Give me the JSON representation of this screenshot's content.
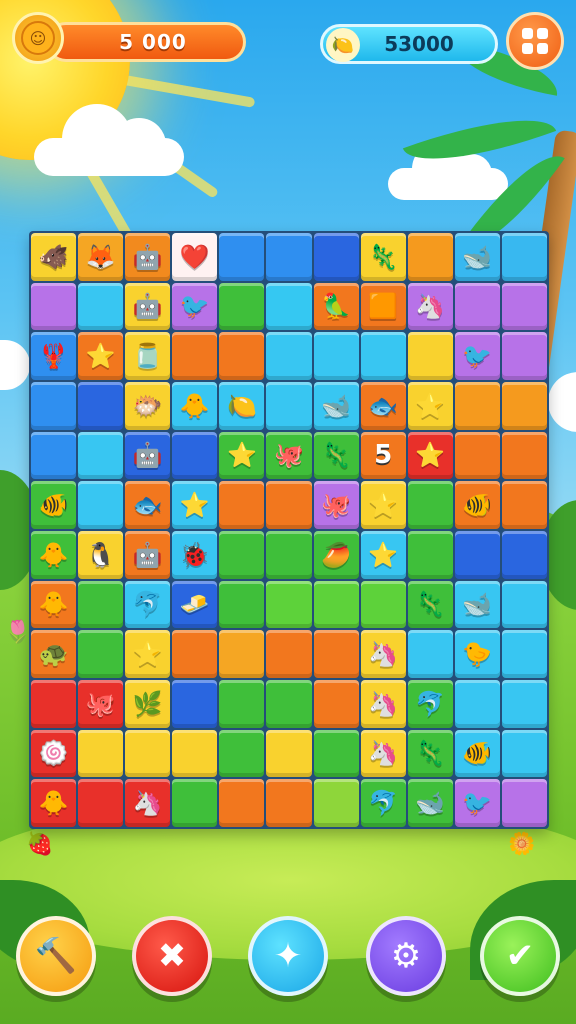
{
  "hud": {
    "score": "5 000",
    "gems": "53000",
    "coin_icon": "coin-icon",
    "gem_icon": "lemon-gem-icon",
    "menu_icon": "grid-menu-icon"
  },
  "board": {
    "cols": 11,
    "rows": 12,
    "cells": [
      [
        "#f9d22e",
        "🐗",
        "#f5a623",
        "🦊",
        "#f28a1e",
        "🤖",
        "#fff2f2",
        "❤️",
        "#2f8ff0",
        "",
        "#2f8ff0",
        "",
        "#2a66e0",
        "",
        "#f9d22e",
        "🦎",
        "#f59a1e",
        "",
        "#38b8f0",
        "🐋",
        "#38b8f0",
        ""
      ],
      [
        "#b772e8",
        "",
        "#38c6f2",
        "",
        "#f9d22e",
        "🤖",
        "#b772e8",
        "🐦",
        "#3fbf3a",
        "",
        "#35c8f2",
        "",
        "#f2771e",
        "🦜",
        "#f2771e",
        "🟧",
        "#b772e8",
        "🦄",
        "#b772e8",
        "",
        "#b772e8",
        ""
      ],
      [
        "#2f8ff0",
        "🦞",
        "#f2771e",
        "⭐",
        "#f9d22e",
        "🫙",
        "#f2771e",
        "",
        "#f2771e",
        "",
        "#38c6f2",
        "",
        "#38c6f2",
        "",
        "#38c6f2",
        "",
        "#f9d22e",
        "",
        "#b772e8",
        "🐦",
        "#b772e8",
        ""
      ],
      [
        "#2f8ff0",
        "",
        "#2a66e0",
        "",
        "#f9d22e",
        "🐡",
        "#38c6f2",
        "🐥",
        "#38c6f2",
        "🍋",
        "#38c6f2",
        "",
        "#38c6f2",
        "🐋",
        "#f2771e",
        "🐟",
        "#f9d22e",
        "⭐",
        "#f59a1e",
        "",
        "#f59a1e",
        ""
      ],
      [
        "#2f8ff0",
        "",
        "#38c6f2",
        "",
        "#2a66e0",
        "🤖",
        "#2a66e0",
        "",
        "#3fbf3a",
        "⭐",
        "#3fbf3a",
        "🐙",
        "#3fbf3a",
        "🦎",
        "#f2771e",
        "5",
        "#e8302a",
        "⭐",
        "#f2771e",
        "",
        "#f2771e",
        ""
      ],
      [
        "#3fbf3a",
        "🐠",
        "#38c6f2",
        "",
        "#f2771e",
        "🐟",
        "#38c6f2",
        "⭐",
        "#f2771e",
        "",
        "#f2771e",
        "",
        "#b772e8",
        "🐙",
        "#f9d22e",
        "⭐",
        "#3fbf3a",
        "",
        "#f2771e",
        "🐠",
        "#f2771e",
        ""
      ],
      [
        "#3fbf3a",
        "🐥",
        "#f9d22e",
        "🐧",
        "#f2771e",
        "🤖",
        "#38c6f2",
        "🐞",
        "#3fbf3a",
        "",
        "#3fbf3a",
        "",
        "#3fbf3a",
        "🥭",
        "#38c6f2",
        "⭐",
        "#3fbf3a",
        "",
        "#2a66e0",
        "",
        "#2a66e0",
        ""
      ],
      [
        "#f2771e",
        "🐥",
        "#3fbf3a",
        "",
        "#38c6f2",
        "🐬",
        "#2a66e0",
        "🧈",
        "#3fbf3a",
        "",
        "#5dd23a",
        "",
        "#5dd23a",
        "",
        "#5dd23a",
        "",
        "#3fbf3a",
        "🦎",
        "#38c6f2",
        "🐋",
        "#38c6f2",
        ""
      ],
      [
        "#f2771e",
        "🐢",
        "#3fbf3a",
        "",
        "#f9d22e",
        "⭐",
        "#f2771e",
        "",
        "#f5a623",
        "",
        "#f2771e",
        "",
        "#f2771e",
        "",
        "#f9d22e",
        "🦄",
        "#38c6f2",
        "",
        "#38c6f2",
        "🐤",
        "#38c6f2",
        ""
      ],
      [
        "#e8302a",
        "",
        "#e8302a",
        "🐙",
        "#f9d22e",
        "🌿",
        "#2a66e0",
        "",
        "#3fbf3a",
        "",
        "#3fbf3a",
        "",
        "#f2771e",
        "",
        "#f9d22e",
        "🦄",
        "#3fbf3a",
        "🐬",
        "#38c6f2",
        "",
        "#38c6f2",
        ""
      ],
      [
        "#e8302a",
        "🍥",
        "#f9d22e",
        "",
        "#f9d22e",
        "",
        "#f9d22e",
        "",
        "#3fbf3a",
        "",
        "#f9d22e",
        "",
        "#3fbf3a",
        "",
        "#f9d22e",
        "🦄",
        "#3fbf3a",
        "🦎",
        "#38c6f2",
        "🐠",
        "#38c6f2",
        ""
      ],
      [
        "#e8302a",
        "🐥",
        "#e8302a",
        "",
        "#e8302a",
        "🦄",
        "#3fbf3a",
        "",
        "#f2771e",
        "",
        "#f2771e",
        "",
        "#8ed63a",
        "",
        "#3fbf3a",
        "🐬",
        "#3fbf3a",
        "🐋",
        "#b772e8",
        "🐦",
        "#b772e8",
        ""
      ]
    ]
  },
  "buttons": [
    {
      "name": "hammer-button",
      "icon": "hammer-icon",
      "glyph": "🔨"
    },
    {
      "name": "bomb-button",
      "icon": "bomb-x-icon",
      "glyph": "✖"
    },
    {
      "name": "shuffle-button",
      "icon": "puzzle-icon",
      "glyph": "✦"
    },
    {
      "name": "settings-button",
      "icon": "gear-icon",
      "glyph": "⚙"
    },
    {
      "name": "confirm-button",
      "icon": "check-icon",
      "glyph": "✔"
    }
  ]
}
